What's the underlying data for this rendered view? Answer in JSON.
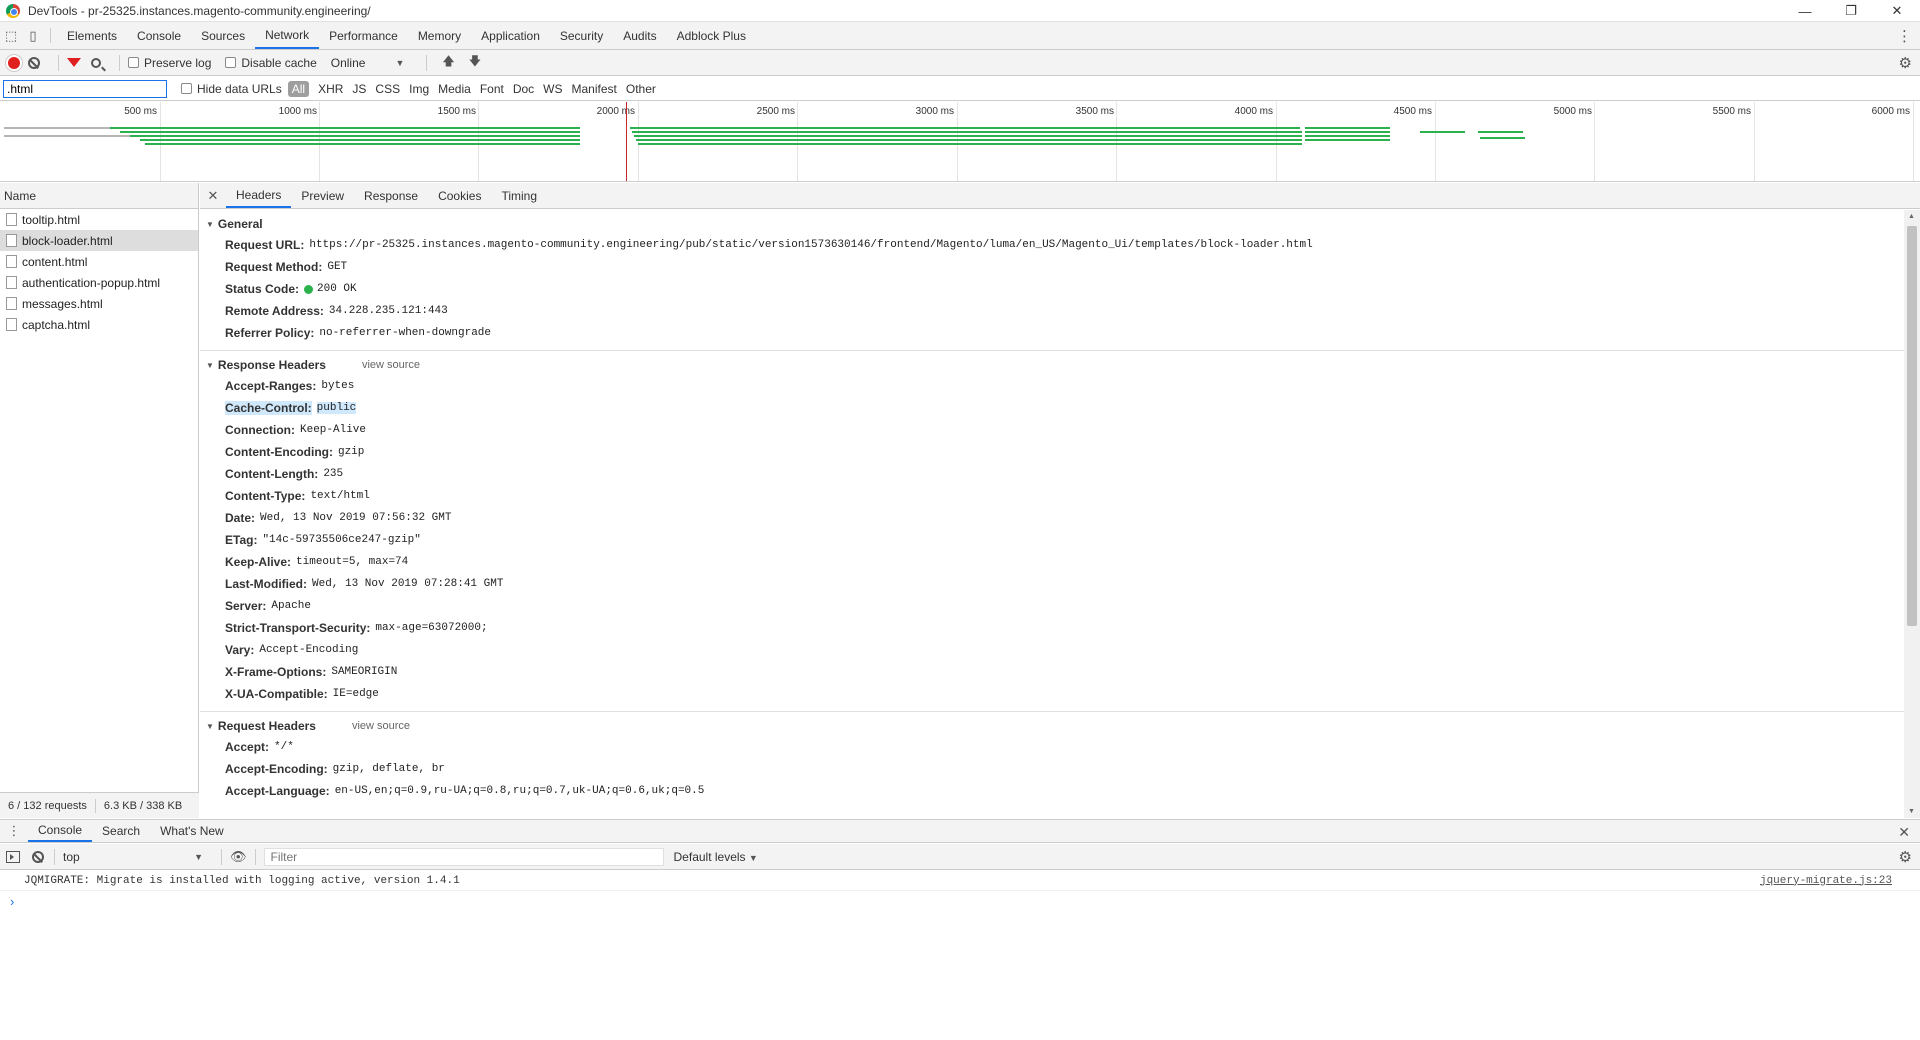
{
  "window": {
    "title": "DevTools - pr-25325.instances.magento-community.engineering/",
    "minimize": "—",
    "maximize": "❐",
    "close": "✕"
  },
  "main_tabs": [
    "Elements",
    "Console",
    "Sources",
    "Network",
    "Performance",
    "Memory",
    "Application",
    "Security",
    "Audits",
    "Adblock Plus"
  ],
  "network_toolbar": {
    "preserve_log": "Preserve log",
    "disable_cache": "Disable cache",
    "throttle": "Online"
  },
  "filter": {
    "value": ".html",
    "hide_data_urls": "Hide data URLs",
    "types": [
      "All",
      "XHR",
      "JS",
      "CSS",
      "Img",
      "Media",
      "Font",
      "Doc",
      "WS",
      "Manifest",
      "Other"
    ],
    "active_type": "All"
  },
  "timeline": {
    "ticks": [
      "500 ms",
      "1000 ms",
      "1500 ms",
      "2000 ms",
      "2500 ms",
      "3000 ms",
      "3500 ms",
      "4000 ms",
      "4500 ms",
      "5000 ms",
      "5500 ms",
      "6000 ms"
    ]
  },
  "requests": {
    "header": "Name",
    "items": [
      "tooltip.html",
      "block-loader.html",
      "content.html",
      "authentication-popup.html",
      "messages.html",
      "captcha.html"
    ],
    "selected_index": 1,
    "summary_requests": "6 / 132 requests",
    "summary_size": "6.3 KB / 338 KB"
  },
  "detail_tabs": [
    "Headers",
    "Preview",
    "Response",
    "Cookies",
    "Timing"
  ],
  "detail_close": "✕",
  "general": {
    "title": "General",
    "rows": [
      {
        "k": "Request URL:",
        "v": "https://pr-25325.instances.magento-community.engineering/pub/static/version1573630146/frontend/Magento/luma/en_US/Magento_Ui/templates/block-loader.html"
      },
      {
        "k": "Request Method:",
        "v": "GET"
      },
      {
        "k": "Status Code:",
        "v": "200 OK"
      },
      {
        "k": "Remote Address:",
        "v": "34.228.235.121:443"
      },
      {
        "k": "Referrer Policy:",
        "v": "no-referrer-when-downgrade"
      }
    ]
  },
  "response_headers": {
    "title": "Response Headers",
    "view_source": "view source",
    "rows": [
      {
        "k": "Accept-Ranges:",
        "v": "bytes"
      },
      {
        "k": "Cache-Control:",
        "v": "public"
      },
      {
        "k": "Connection:",
        "v": "Keep-Alive"
      },
      {
        "k": "Content-Encoding:",
        "v": "gzip"
      },
      {
        "k": "Content-Length:",
        "v": "235"
      },
      {
        "k": "Content-Type:",
        "v": "text/html"
      },
      {
        "k": "Date:",
        "v": "Wed, 13 Nov 2019 07:56:32 GMT"
      },
      {
        "k": "ETag:",
        "v": "\"14c-59735506ce247-gzip\""
      },
      {
        "k": "Keep-Alive:",
        "v": "timeout=5, max=74"
      },
      {
        "k": "Last-Modified:",
        "v": "Wed, 13 Nov 2019 07:28:41 GMT"
      },
      {
        "k": "Server:",
        "v": "Apache"
      },
      {
        "k": "Strict-Transport-Security:",
        "v": "max-age=63072000;"
      },
      {
        "k": "Vary:",
        "v": "Accept-Encoding"
      },
      {
        "k": "X-Frame-Options:",
        "v": "SAMEORIGIN"
      },
      {
        "k": "X-UA-Compatible:",
        "v": "IE=edge"
      }
    ]
  },
  "request_headers": {
    "title": "Request Headers",
    "view_source": "view source",
    "rows": [
      {
        "k": "Accept:",
        "v": "*/*"
      },
      {
        "k": "Accept-Encoding:",
        "v": "gzip, deflate, br"
      },
      {
        "k": "Accept-Language:",
        "v": "en-US,en;q=0.9,ru-UA;q=0.8,ru;q=0.7,uk-UA;q=0.6,uk;q=0.5"
      }
    ]
  },
  "drawer": {
    "tabs": [
      "Console",
      "Search",
      "What's New"
    ],
    "context": "top",
    "filter_placeholder": "Filter",
    "levels": "Default levels",
    "message": "JQMIGRATE: Migrate is installed with logging active, version 1.4.1",
    "message_source": "jquery-migrate.js:23",
    "prompt": "›"
  },
  "colors": {
    "accent": "#1a73e8",
    "record": "#e0201f",
    "bar_green": "#2bb24c",
    "highlight": "#cfe8fc"
  }
}
